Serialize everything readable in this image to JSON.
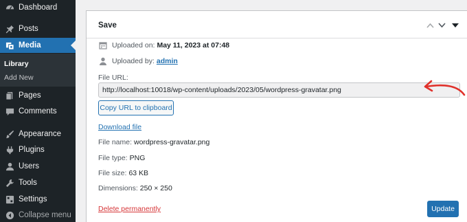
{
  "sidebar": {
    "items": [
      {
        "label": "Dashboard",
        "icon": "dashboard-icon"
      },
      {
        "label": "Posts",
        "icon": "pin-icon"
      },
      {
        "label": "Media",
        "icon": "media-icon"
      },
      {
        "label": "Pages",
        "icon": "pages-icon"
      },
      {
        "label": "Comments",
        "icon": "comments-icon"
      },
      {
        "label": "Appearance",
        "icon": "brush-icon"
      },
      {
        "label": "Plugins",
        "icon": "plugins-icon"
      },
      {
        "label": "Users",
        "icon": "users-icon"
      },
      {
        "label": "Tools",
        "icon": "wrench-icon"
      },
      {
        "label": "Settings",
        "icon": "settings-icon"
      },
      {
        "label": "Collapse menu",
        "icon": "collapse-icon"
      }
    ],
    "submenu": [
      {
        "label": "Library"
      },
      {
        "label": "Add New"
      }
    ],
    "active": "Media",
    "accent_color": "#2271b1",
    "background_color": "#1d2327"
  },
  "panel": {
    "title": "Save",
    "uploaded_on_label": "Uploaded on:",
    "uploaded_on_value": "May 11, 2023 at 07:48",
    "uploaded_by_label": "Uploaded by:",
    "uploaded_by_value": "admin",
    "file_url_label": "File URL:",
    "file_url_value": "http://localhost:10018/wp-content/uploads/2023/05/wordpress-gravatar.png",
    "copy_button": "Copy URL to clipboard",
    "download_link": "Download file",
    "file_name_label": "File name:",
    "file_name_value": "wordpress-gravatar.png",
    "file_type_label": "File type:",
    "file_type_value": "PNG",
    "file_size_label": "File size:",
    "file_size_value": "63 KB",
    "dimensions_label": "Dimensions:",
    "dimensions_value": "250 × 250",
    "delete_link": "Delete permanently",
    "update_button": "Update",
    "delete_color": "#d63638",
    "annotation_color": "#e0312b"
  }
}
